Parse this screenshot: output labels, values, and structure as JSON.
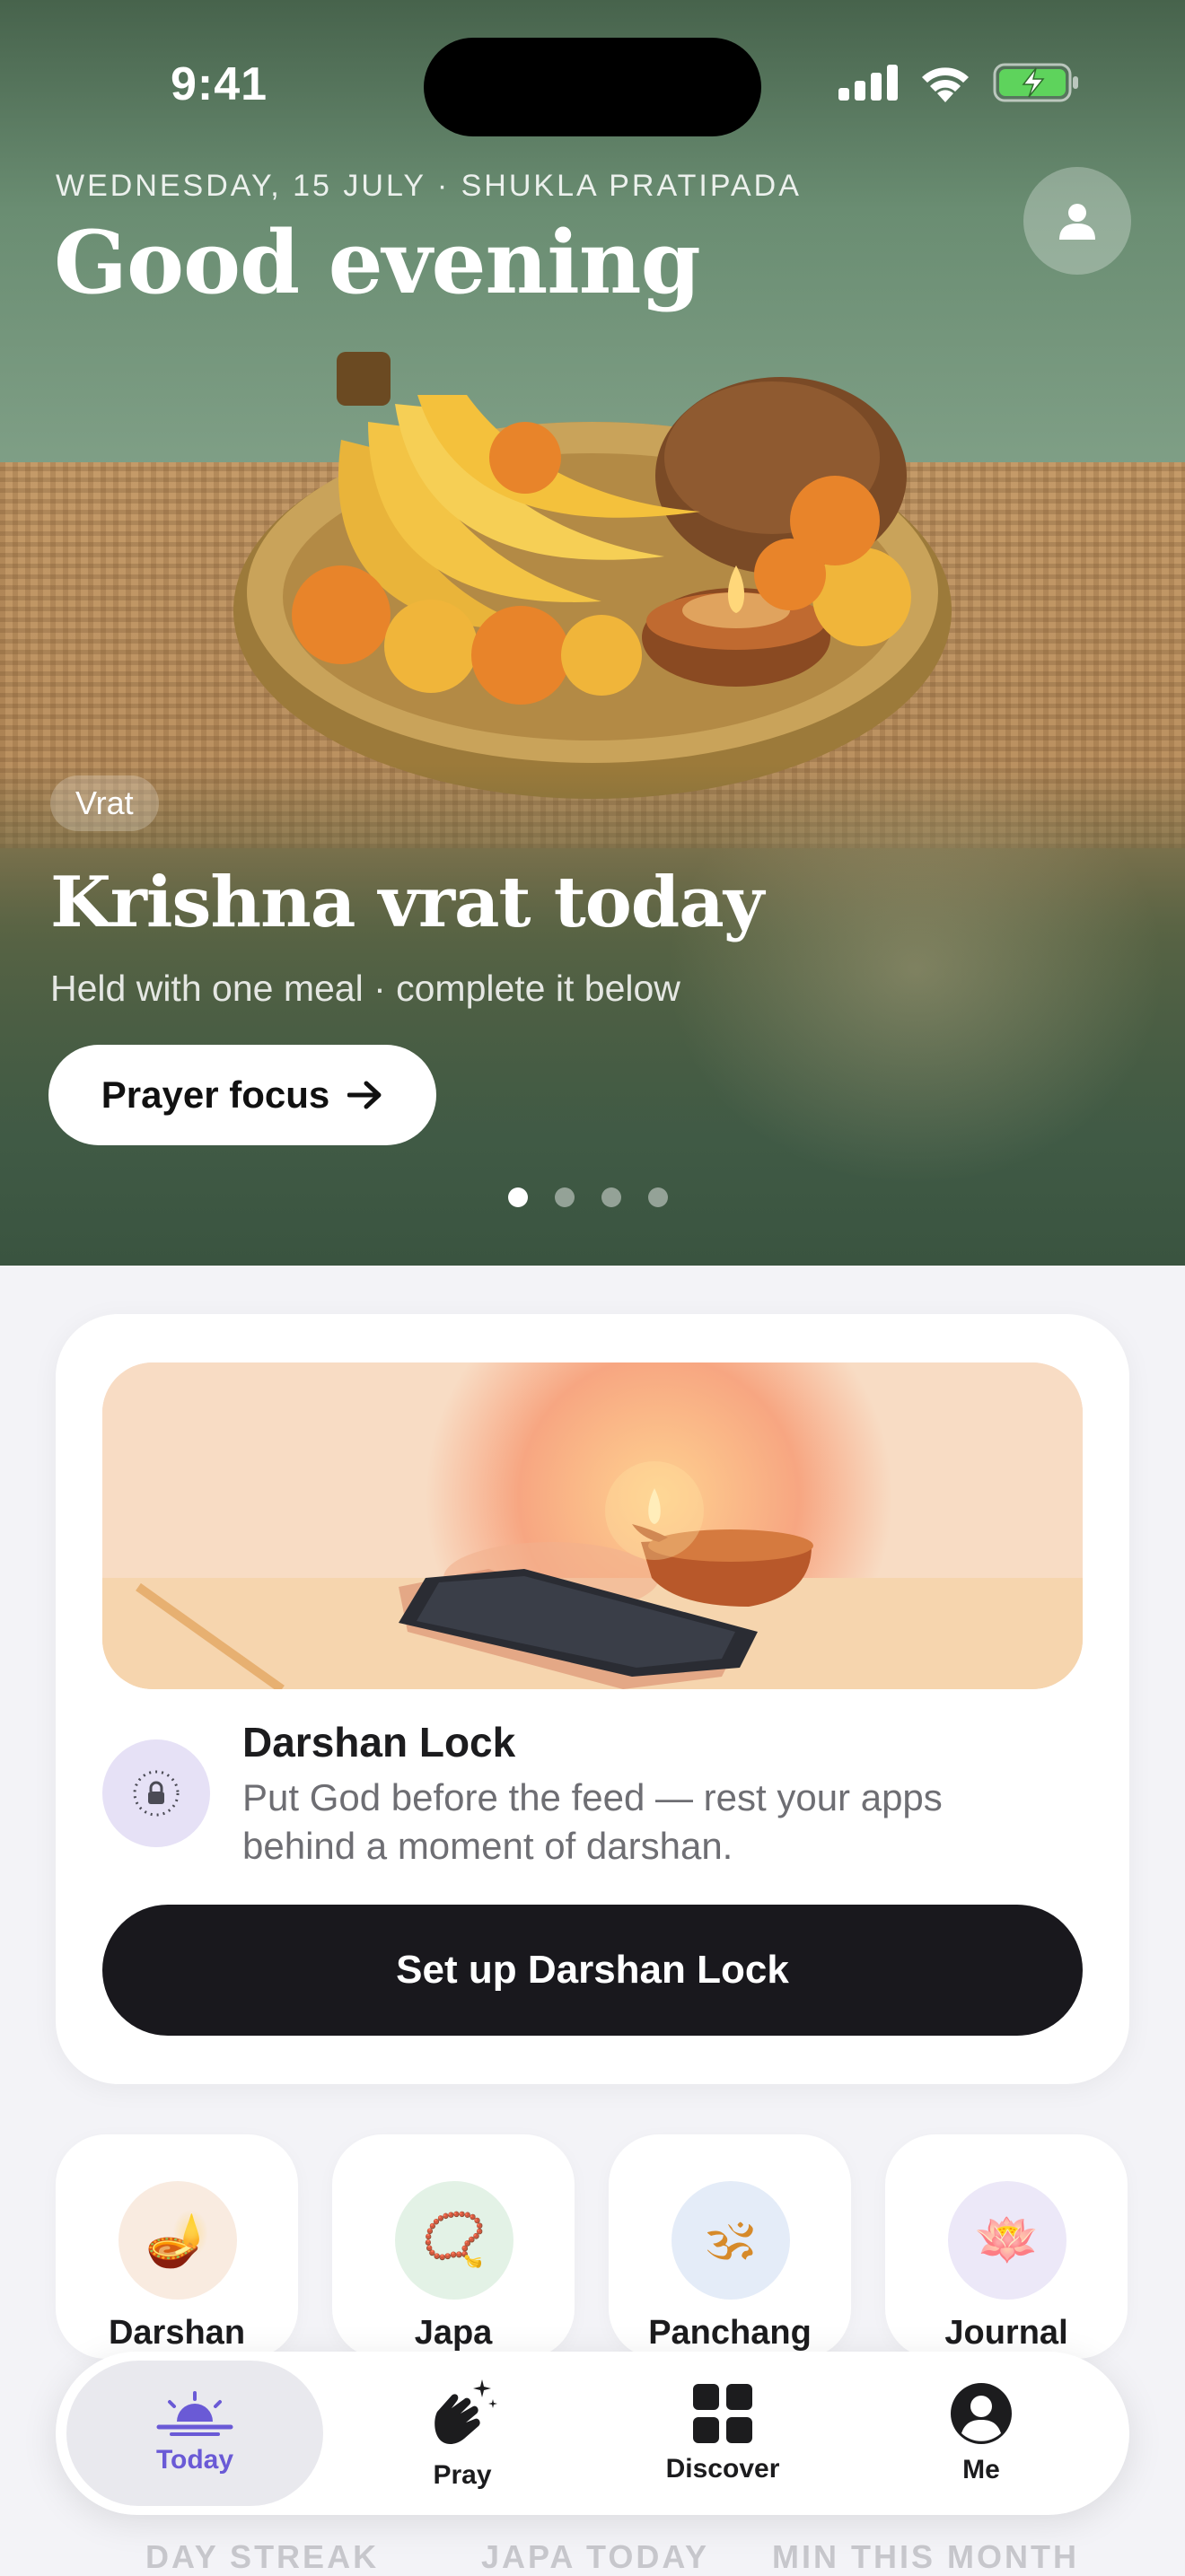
{
  "status_bar": {
    "time": "9:41"
  },
  "hero": {
    "date_line": "WEDNESDAY, 15 JULY · SHUKLA PRATIPADA",
    "greeting": "Good evening",
    "tag": "Vrat",
    "title": "Krishna vrat today",
    "subtitle": "Held with one meal · complete it below",
    "cta_label": "Prayer focus",
    "carousel": {
      "pages": 4,
      "active_index": 0
    }
  },
  "darshan_lock": {
    "title": "Darshan Lock",
    "description": "Put God before the feed — rest your apps behind a moment of darshan.",
    "button_label": "Set up Darshan Lock"
  },
  "quick_actions": [
    {
      "label": "Darshan",
      "icon": "diya-icon",
      "glyph": "🪔",
      "bg": "#f9ebe0"
    },
    {
      "label": "Japa",
      "icon": "mala-beads-icon",
      "glyph": "📿",
      "bg": "#e3f2e6"
    },
    {
      "label": "Panchang",
      "icon": "om-icon",
      "glyph": "🕉",
      "bg": "#e4ecf8"
    },
    {
      "label": "Journal",
      "icon": "lotus-icon",
      "glyph": "🪷",
      "bg": "#ece8f8"
    }
  ],
  "stats_labels": [
    "DAY STREAK",
    "JAPA TODAY",
    "MIN THIS MONTH"
  ],
  "tab_bar": {
    "tabs": [
      {
        "label": "Today",
        "icon": "sunrise-icon",
        "active": true
      },
      {
        "label": "Pray",
        "icon": "praying-hands-icon",
        "active": false
      },
      {
        "label": "Discover",
        "icon": "grid-icon",
        "active": false
      },
      {
        "label": "Me",
        "icon": "person-circle-icon",
        "active": false
      }
    ]
  },
  "colors": {
    "accent": "#6a5ad6",
    "button_dark": "#19181d",
    "hero_green": "#4b6b52"
  }
}
